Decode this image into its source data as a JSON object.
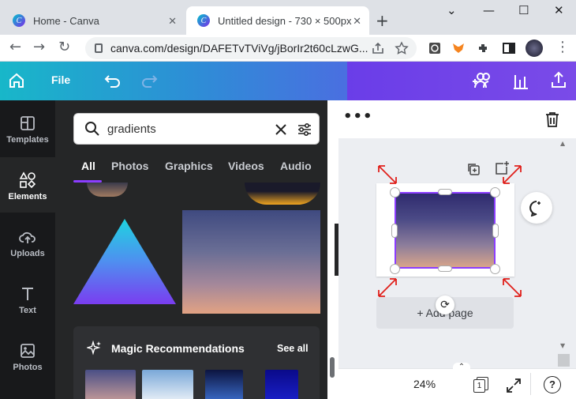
{
  "browser": {
    "tabs": [
      {
        "title": "Home - Canva",
        "active": false
      },
      {
        "title": "Untitled design - 730 × 500px",
        "active": true
      }
    ],
    "url": "canva.com/design/DAFETvTViVg/jBorIr2t60cLzwG..."
  },
  "header": {
    "file_label": "File"
  },
  "rail": {
    "items": [
      {
        "label": "Templates",
        "active": false
      },
      {
        "label": "Elements",
        "active": true
      },
      {
        "label": "Uploads",
        "active": false
      },
      {
        "label": "Text",
        "active": false
      },
      {
        "label": "Photos",
        "active": false
      }
    ]
  },
  "panel": {
    "search_value": "gradients",
    "tabs": [
      "All",
      "Photos",
      "Graphics",
      "Videos",
      "Audio"
    ],
    "active_tab": "All",
    "magic_title": "Magic Recommendations",
    "see_all": "See all"
  },
  "canvas": {
    "add_page_label": "+ Add page",
    "zoom": "24%",
    "page_number": "1"
  },
  "colors": {
    "accent": "#8b3dff",
    "header_teal": "#00c4cc",
    "panel_bg": "#252627",
    "rail_bg": "#18191b",
    "resize_arrow": "#e0201b"
  }
}
